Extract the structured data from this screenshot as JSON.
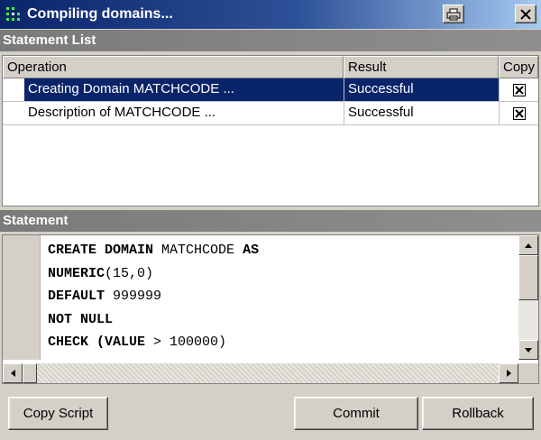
{
  "window": {
    "title": "Compiling domains..."
  },
  "statement_list": {
    "header": "Statement List",
    "columns": [
      "Operation",
      "Result",
      "Copy"
    ],
    "rows": [
      {
        "operation": "Creating Domain MATCHCODE ...",
        "result": "Successful",
        "copy": true,
        "selected": true
      },
      {
        "operation": "Description of MATCHCODE ...",
        "result": "Successful",
        "copy": true,
        "selected": false
      }
    ]
  },
  "statement": {
    "header": "Statement",
    "lines": [
      {
        "kw": "CREATE DOMAIN",
        "rest": " MATCHCODE ",
        "kw2": "AS"
      },
      {
        "kw": "NUMERIC",
        "rest": "(15,0)",
        "kw2": ""
      },
      {
        "kw": "DEFAULT",
        "rest": " 999999",
        "kw2": ""
      },
      {
        "kw": "NOT NULL",
        "rest": "",
        "kw2": ""
      },
      {
        "kw": "CHECK (VALUE",
        "rest": " > 100000)",
        "kw2": ""
      }
    ]
  },
  "buttons": {
    "copy_script": "Copy Script",
    "commit": "Commit",
    "rollback": "Rollback"
  },
  "icons": {
    "app": "app-icon",
    "print": "print-icon",
    "close": "close-icon"
  },
  "colors": {
    "title_bar": "#0a246a",
    "selection": "#0a246a",
    "section_header": "#808080"
  }
}
